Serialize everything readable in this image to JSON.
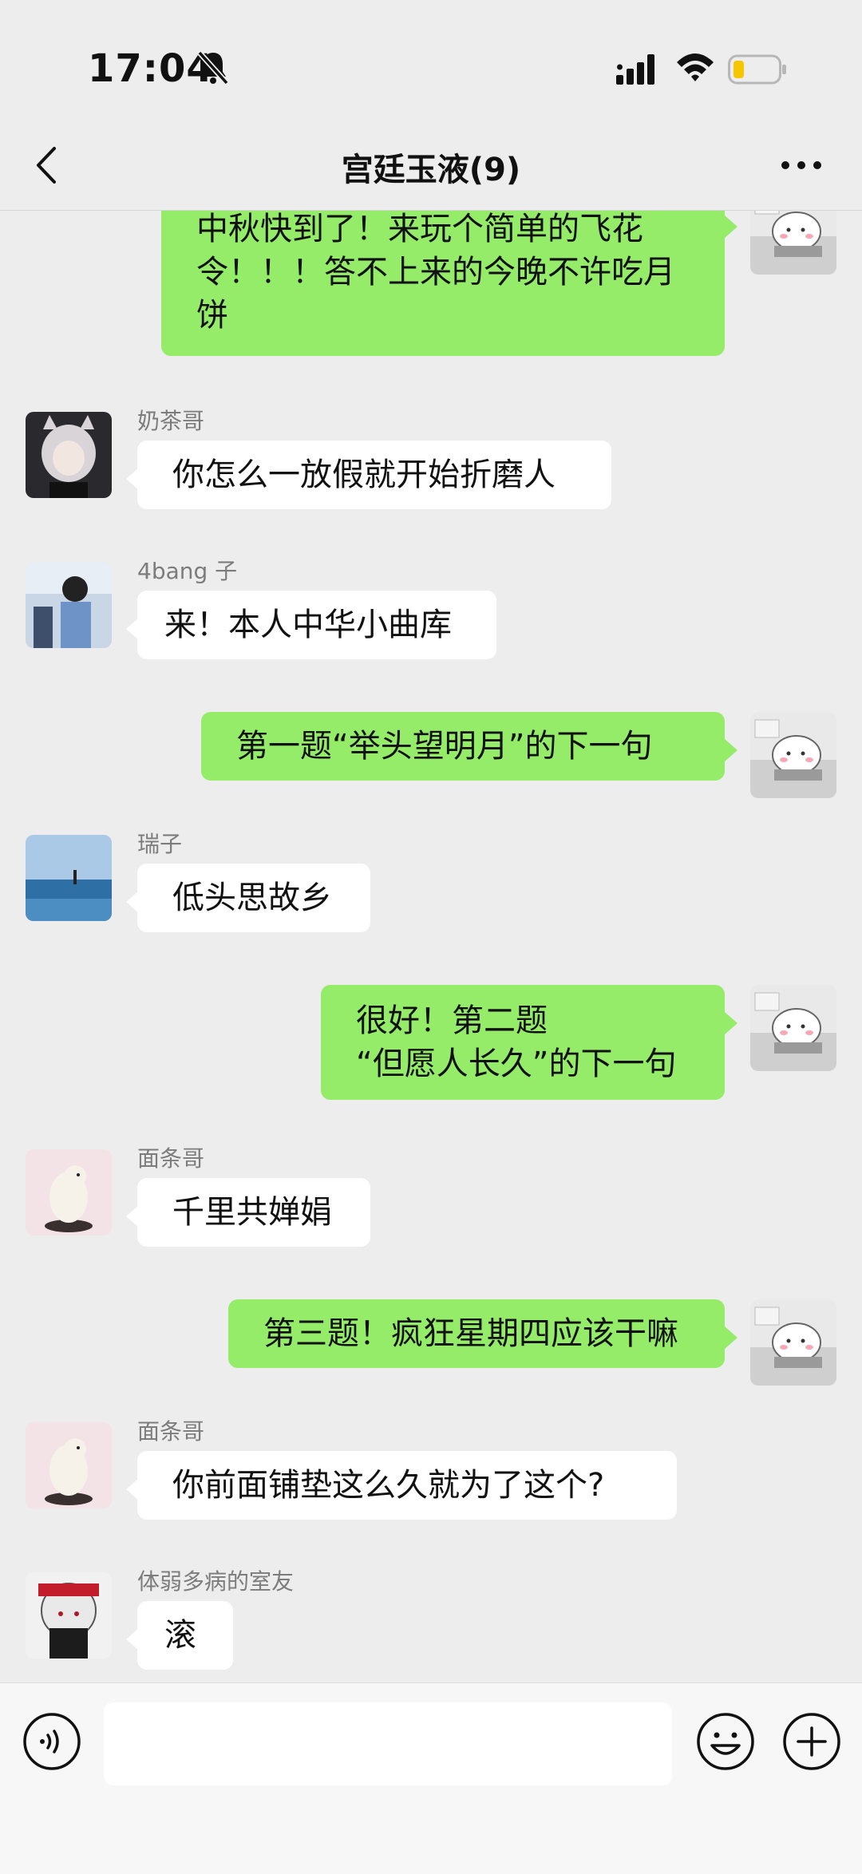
{
  "status_bar": {
    "time": "17:04",
    "battery_color": "#f7c600"
  },
  "nav": {
    "title": "宫廷玉液(9)"
  },
  "messages": [
    {
      "side": "right",
      "lines": [
        "中秋快到了！来玩个简单的飞花",
        "令！！！答不上来的今晚不许吃月",
        "饼"
      ]
    },
    {
      "side": "left",
      "sender": "奶茶哥",
      "lines": [
        "你怎么一放假就开始折磨人"
      ]
    },
    {
      "side": "left",
      "sender": "4bang 子",
      "lines": [
        "来！本人中华小曲库"
      ]
    },
    {
      "side": "right",
      "lines": [
        "第一题“举头望明月”的下一句"
      ]
    },
    {
      "side": "left",
      "sender": "瑞子",
      "lines": [
        "低头思故乡"
      ]
    },
    {
      "side": "right",
      "lines": [
        "很好！第二题",
        "“但愿人长久”的下一句"
      ]
    },
    {
      "side": "left",
      "sender": "面条哥",
      "lines": [
        "千里共婵娟"
      ]
    },
    {
      "side": "right",
      "lines": [
        "第三题！疯狂星期四应该干嘛"
      ]
    },
    {
      "side": "left",
      "sender": "面条哥",
      "lines": [
        "你前面铺垫这么久就为了这个?"
      ]
    },
    {
      "side": "left",
      "sender": "体弱多病的室友",
      "lines": [
        "滚"
      ]
    }
  ],
  "input": {
    "placeholder": ""
  },
  "colors": {
    "bubble_self": "#95ec69",
    "bubble_other": "#ffffff",
    "background": "#ededed"
  }
}
